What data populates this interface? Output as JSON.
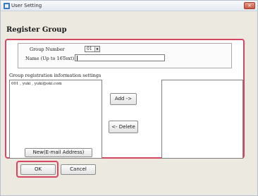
{
  "window": {
    "title": "User Setting",
    "close_label": "×"
  },
  "heading": "Register Group",
  "group_number": {
    "label": "Group Number",
    "selected": "01",
    "arrow": "▼"
  },
  "name_field": {
    "label": "Name (Up to 16Text) :",
    "value": ""
  },
  "registration": {
    "label": "Group registration information settings",
    "items": [
      "001 , yuki , yuki@oki.com"
    ]
  },
  "buttons": {
    "add": "Add ->",
    "delete": "<- Delete",
    "new_email": "New(E-mail Address)",
    "ok": "OK",
    "cancel": "Cancel"
  },
  "colors": {
    "highlight": "#d64561",
    "window_bg": "#ece9e0"
  }
}
